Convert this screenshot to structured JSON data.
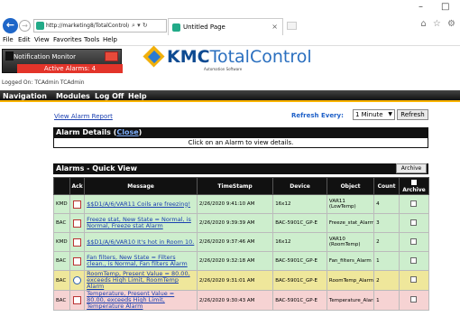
{
  "browser": {
    "address": "http://marketing8/TotalControl/Web/AlarmView",
    "address_controls": "⌕ ▾ ↻",
    "tab_title": "Untitled Page",
    "window_controls": {
      "minimize": "–",
      "maximize": "□"
    },
    "toolbar_icons": "⌂ ☆ ⚙",
    "menu": [
      "File",
      "Edit",
      "View",
      "Favorites",
      "Tools",
      "Help"
    ]
  },
  "header": {
    "notification_label": "Notification Monitor",
    "active_alarms": "Active Alarms: 4",
    "logo_kmc": "KMC",
    "logo_tc": "TotalControl",
    "logo_sub": "Automation Software",
    "logged_on": "Logged On: TCAdmin TCAdmin"
  },
  "nav": [
    "Navigation",
    "Modules",
    "Log Off",
    "Help"
  ],
  "page": {
    "view_report": "View Alarm Report",
    "refresh_label": "Refresh Every:",
    "refresh_value": "1 Minute",
    "refresh_button": "Refresh",
    "details_title": "Alarm Details (",
    "details_close": "Close",
    "details_title_end": ")",
    "details_message": "Click on an Alarm to view details.",
    "quickview_title": "Alarms - Quick View",
    "archive_button": "Archive"
  },
  "table": {
    "headers": {
      "source": "",
      "ack": "Ack",
      "message": "Message",
      "timestamp": "TimeStamp",
      "device": "Device",
      "object": "Object",
      "count": "Count",
      "archive": "Archive"
    },
    "rows": [
      {
        "source": "KMD",
        "ack": "Ack",
        "ack_type": "alarm",
        "message": "$$D1/A/6/VAR11 Coils are freezing!",
        "timestamp": "2/26/2020 9:41:10 AM",
        "device": "16x12",
        "object": "VAR11 (LowTemp)",
        "count": "4",
        "color": "#cdeecd"
      },
      {
        "source": "BAC",
        "ack": "Ack",
        "ack_type": "alarm",
        "message": "Freeze stat, New State = Normal, is Normal, Freeze stat Alarm",
        "timestamp": "2/26/2020 9:39:39 AM",
        "device": "BAC-5901C_GP-E",
        "object": "Freeze_stat_Alarm",
        "count": "3",
        "color": "#cdeecd"
      },
      {
        "source": "KMD",
        "ack": "Ack",
        "ack_type": "check",
        "message": "$$D1/A/6/VAR10 It's hot in Room 10.",
        "timestamp": "2/26/2020 9:37:46 AM",
        "device": "16x12",
        "object": "VAR10 (RoomTemp)",
        "count": "2",
        "color": "#cdeecd"
      },
      {
        "source": "BAC",
        "ack": "Ack",
        "ack_type": "alarm",
        "message": "Fan filters, New State = Filters clean., is Normal, Fan filters Alarm",
        "timestamp": "2/26/2020 9:32:18 AM",
        "device": "BAC-5901C_GP-E",
        "object": "Fan_filters_Alarm",
        "count": "1",
        "color": "#cdeecd"
      },
      {
        "source": "BAC",
        "ack": "Ack",
        "ack_type": "ok",
        "message": "RoomTemp, Present Value = 80.00, exceeds High Limit, RoomTemp Alarm",
        "timestamp": "2/26/2020 9:31:01 AM",
        "device": "BAC-5901C_GP-E",
        "object": "RoomTemp_Alarm",
        "count": "2",
        "color": "#efe79b"
      },
      {
        "source": "BAC",
        "ack": "Ack",
        "ack_type": "alarm",
        "message": "Temperature, Present Value = 80.00, exceeds High Limit, Temperature Alarm",
        "timestamp": "2/26/2020 9:30:43 AM",
        "device": "BAC-5901C_GP-E",
        "object": "Temperature_Alarm",
        "count": "1",
        "color": "#f6d3d3"
      }
    ]
  },
  "colors": {
    "accent": "#ffb400",
    "nav_bg": "#111111",
    "alarm_red": "#e3342a",
    "link": "#1a3fb0"
  }
}
